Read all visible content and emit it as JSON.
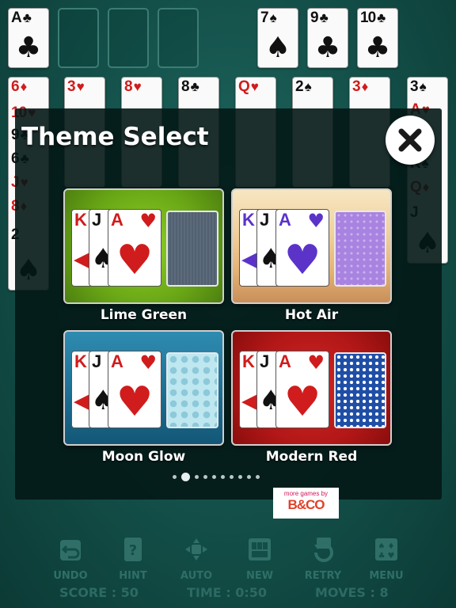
{
  "foundations": [
    {
      "rank": "A",
      "suit": "♣",
      "color": "blk"
    },
    {
      "rank": "7",
      "suit": "♠",
      "color": "blk"
    },
    {
      "rank": "9",
      "suit": "♣",
      "color": "blk"
    },
    {
      "rank": "10",
      "suit": "♣",
      "color": "blk"
    }
  ],
  "tableau_tops": [
    {
      "rank": "6",
      "suit": "♦",
      "color": "red"
    },
    {
      "rank": "3",
      "suit": "♥",
      "color": "red"
    },
    {
      "rank": "8",
      "suit": "♥",
      "color": "red"
    },
    {
      "rank": "8",
      "suit": "♣",
      "color": "blk"
    },
    {
      "rank": "Q",
      "suit": "♥",
      "color": "red"
    },
    {
      "rank": "2",
      "suit": "♠",
      "color": "blk"
    },
    {
      "rank": "3",
      "suit": "♦",
      "color": "red"
    },
    {
      "rank": "3",
      "suit": "♠",
      "color": "blk"
    }
  ],
  "column1_cards": [
    {
      "rank": "10",
      "suit": "♥",
      "color": "red"
    },
    {
      "rank": "9",
      "suit": "♣",
      "color": "blk"
    },
    {
      "rank": "6",
      "suit": "♣",
      "color": "blk"
    },
    {
      "rank": "J",
      "suit": "♥",
      "color": "red"
    },
    {
      "rank": "8",
      "suit": "♦",
      "color": "red"
    },
    {
      "rank": "2",
      "suit": "♠",
      "color": "blk"
    }
  ],
  "column8_cards": [
    {
      "rank": "A",
      "suit": "♥",
      "color": "red"
    },
    {
      "rank": "K",
      "suit": "♠",
      "color": "blk"
    },
    {
      "rank": "Q",
      "suit": "♦",
      "color": "red"
    },
    {
      "rank": "J",
      "suit": "♠",
      "color": "blk"
    }
  ],
  "modal": {
    "title": "Theme Select",
    "themes": [
      {
        "name": "Lime Green"
      },
      {
        "name": "Hot Air"
      },
      {
        "name": "Moon Glow"
      },
      {
        "name": "Modern Red"
      }
    ],
    "pages_total": 10,
    "page_active": 1
  },
  "brand": {
    "small": "more games by",
    "big": "B&CO"
  },
  "toolbar": {
    "undo": "UNDO",
    "hint": "HINT",
    "auto": "AUTO",
    "new": "NEW",
    "retry": "RETRY",
    "menu": "MENU"
  },
  "status": {
    "score_label": "SCORE :",
    "score": "50",
    "time_label": "TIME :",
    "time": "0:50",
    "moves_label": "MOVES :",
    "moves": "8"
  },
  "colors": {
    "felt": "#1a5f58",
    "accent_red": "#d01c1c"
  }
}
